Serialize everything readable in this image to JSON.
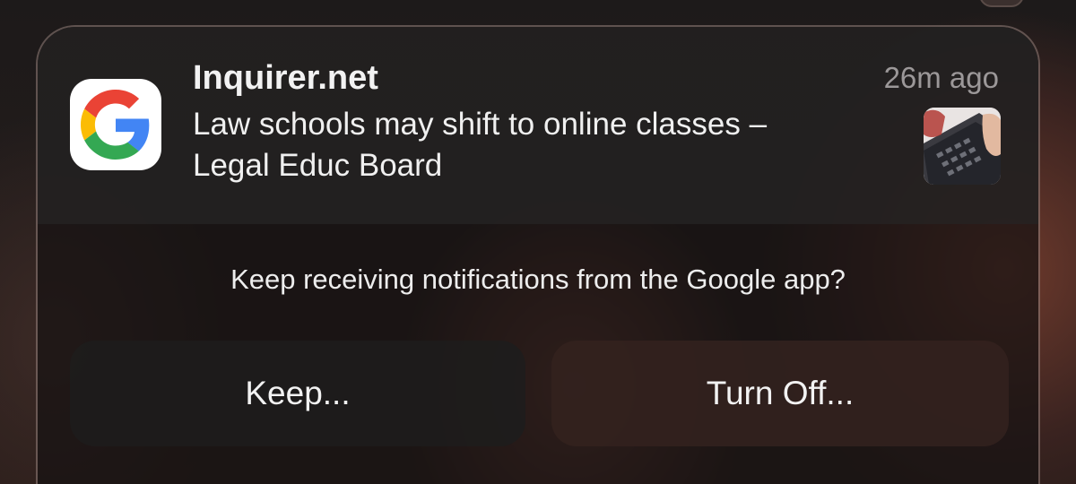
{
  "notification": {
    "app_icon": "google-g-icon",
    "source": "Inquirer.net",
    "time": "26m ago",
    "message_line1": "Law schools may shift to online classes –",
    "message_line2": "Legal Educ Board",
    "thumbnail": "laptop-keyboard-thumbnail"
  },
  "prompt": {
    "text": "Keep receiving notifications from the Google app?"
  },
  "actions": {
    "keep_label": "Keep...",
    "turn_off_label": "Turn Off..."
  },
  "colors": {
    "google_blue": "#4285F4",
    "google_red": "#EA4335",
    "google_yellow": "#FBBC05",
    "google_green": "#34A853"
  }
}
